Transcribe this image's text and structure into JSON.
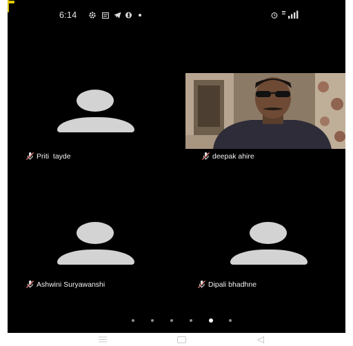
{
  "status_bar": {
    "time": "6:14",
    "left_icons": [
      "gear-icon",
      "message-icon",
      "telegram-icon",
      "bluetooth-icon",
      "dot-icon"
    ],
    "right_icons": [
      "alarm-icon",
      "signal-icon",
      "battery-icon"
    ],
    "colors": {
      "battery": "#d8c000"
    }
  },
  "participants": [
    {
      "name": "Priti  tayde",
      "video": false,
      "muted": true
    },
    {
      "name": "deepak ahire",
      "video": true,
      "muted": true
    },
    {
      "name": "Ashwini Suryawanshi",
      "video": false,
      "muted": true
    },
    {
      "name": "Dipali bhadhne",
      "video": false,
      "muted": true
    }
  ],
  "pager": {
    "pages": 6,
    "active_page": 5
  },
  "nav_bar": {
    "icons": [
      "menu-icon",
      "home-icon",
      "back-icon"
    ]
  },
  "colors": {
    "screen_bg": "#000000",
    "avatar": "#d3d3d3",
    "text": "#f2f2f2",
    "mute_icon": "#e07a7a"
  }
}
